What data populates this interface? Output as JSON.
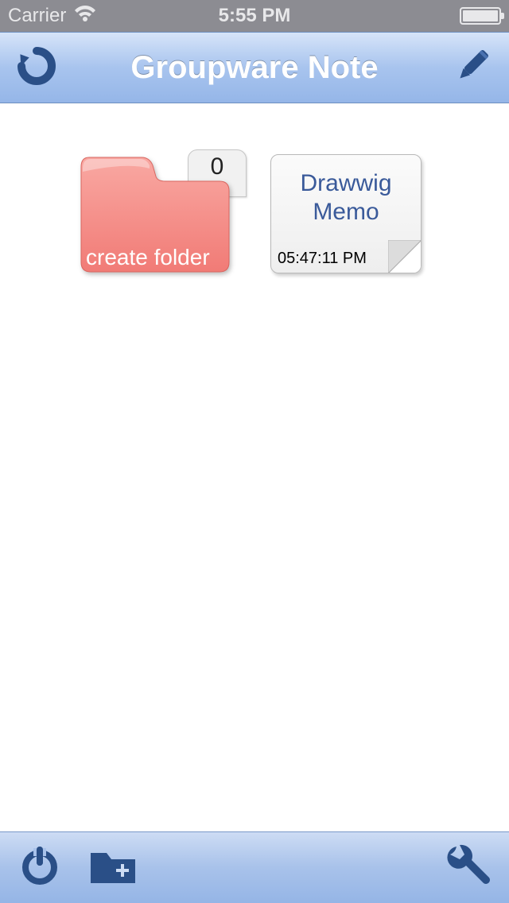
{
  "statusbar": {
    "carrier": "Carrier",
    "time": "5:55 PM"
  },
  "navbar": {
    "title": "Groupware Note"
  },
  "content": {
    "folder": {
      "label": "create folder",
      "count": "0"
    },
    "note": {
      "title": "Drawwig Memo",
      "timestamp": "05:47:11 PM"
    }
  },
  "colors": {
    "folder": "#f58a86",
    "accent": "#2a4f87"
  }
}
